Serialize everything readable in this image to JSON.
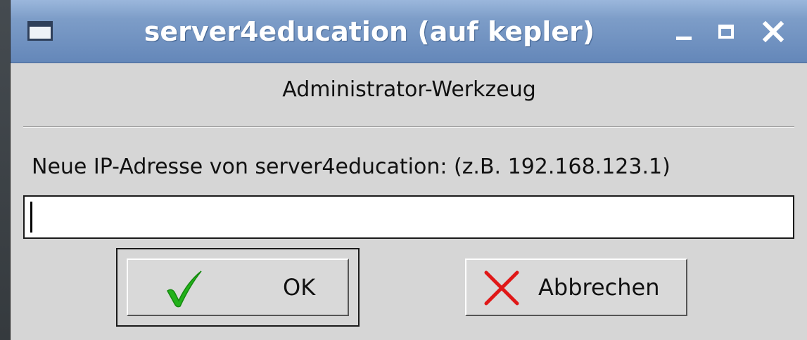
{
  "window": {
    "title": "server4education (auf kepler)",
    "controls": {
      "minimize": "minimize",
      "maximize": "maximize",
      "close": "close"
    }
  },
  "dialog": {
    "heading": "Administrator-Werkzeug",
    "prompt": "Neue IP-Adresse von server4education: (z.B. 192.168.123.1)",
    "ip_input": {
      "value": "",
      "placeholder": ""
    },
    "buttons": {
      "ok": {
        "label": "OK",
        "icon": "checkmark-icon",
        "icon_color": "#22b21a",
        "focused": true
      },
      "cancel": {
        "label": "Abbrechen",
        "icon": "x-cross-icon",
        "icon_color": "#e01818"
      }
    }
  },
  "colors": {
    "titlebar_top": "#9bb7dc",
    "titlebar_bottom": "#6487b9",
    "dialog_background": "#d6d6d6"
  }
}
